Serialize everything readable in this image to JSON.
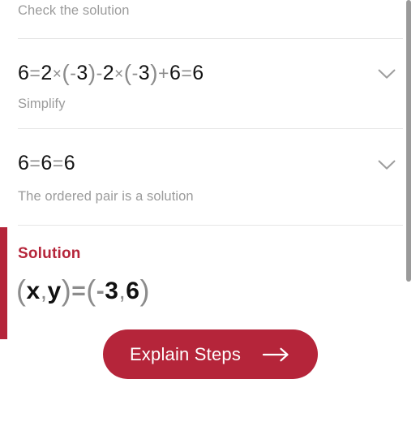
{
  "panel": {
    "accent_color": "#b5253a",
    "background": "#ffffff",
    "caption_color": "#9b9b9b",
    "operator_color": "#8c8c8c"
  },
  "header": {
    "caption": "Check the solution"
  },
  "steps": [
    {
      "expression_parts": [
        {
          "text": "6",
          "kind": "num"
        },
        {
          "text": "=",
          "kind": "op"
        },
        {
          "text": "2",
          "kind": "num"
        },
        {
          "text": "×",
          "kind": "times"
        },
        {
          "text": "(",
          "kind": "paren"
        },
        {
          "text": "-",
          "kind": "op"
        },
        {
          "text": "3",
          "kind": "num"
        },
        {
          "text": ")",
          "kind": "paren"
        },
        {
          "text": "-",
          "kind": "op"
        },
        {
          "text": "2",
          "kind": "num"
        },
        {
          "text": "×",
          "kind": "times"
        },
        {
          "text": "(",
          "kind": "paren"
        },
        {
          "text": "-",
          "kind": "op"
        },
        {
          "text": "3",
          "kind": "num"
        },
        {
          "text": ")",
          "kind": "paren"
        },
        {
          "text": "+",
          "kind": "op"
        },
        {
          "text": "6",
          "kind": "num"
        },
        {
          "text": "=",
          "kind": "op"
        },
        {
          "text": "6",
          "kind": "num"
        }
      ],
      "expression_plain": "6=2×(-3)-2×(-3)+6=6",
      "caption": "Simplify",
      "expand_icon": "chevron-down-icon"
    },
    {
      "expression_parts": [
        {
          "text": "6",
          "kind": "num"
        },
        {
          "text": "=",
          "kind": "op"
        },
        {
          "text": "6",
          "kind": "num"
        },
        {
          "text": "=",
          "kind": "op"
        },
        {
          "text": "6",
          "kind": "num"
        }
      ],
      "expression_plain": "6=6=6",
      "caption": "The ordered pair is a solution",
      "expand_icon": "chevron-down-icon"
    }
  ],
  "solution": {
    "title": "Solution",
    "expression_parts": [
      {
        "text": "(",
        "kind": "paren"
      },
      {
        "text": "x",
        "kind": "var"
      },
      {
        "text": ",",
        "kind": "comma"
      },
      {
        "text": "y",
        "kind": "var"
      },
      {
        "text": ")",
        "kind": "paren"
      },
      {
        "text": "=",
        "kind": "op"
      },
      {
        "text": "(",
        "kind": "paren"
      },
      {
        "text": "-",
        "kind": "op"
      },
      {
        "text": "3",
        "kind": "num"
      },
      {
        "text": ",",
        "kind": "comma"
      },
      {
        "text": "6",
        "kind": "num"
      },
      {
        "text": ")",
        "kind": "paren"
      }
    ],
    "expression_plain": "(x,y)=(-3,6)",
    "x_value": "-3",
    "y_value": "6"
  },
  "explain_button": {
    "label": "Explain Steps",
    "icon": "arrow-right-icon",
    "background": "#b5253a",
    "text_color": "#ffffff"
  },
  "scrollbar": {
    "thumb_color": "#9a9a9a"
  }
}
